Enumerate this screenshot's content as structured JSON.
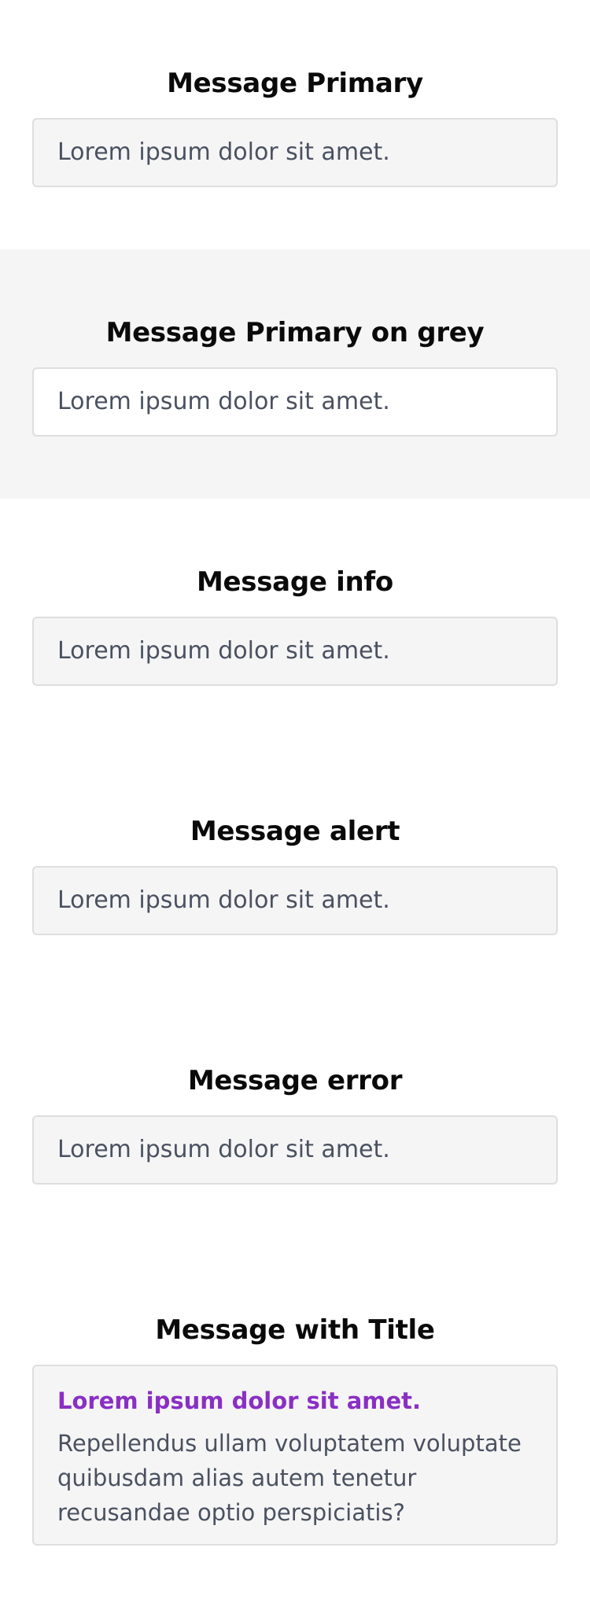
{
  "sections": [
    {
      "title": "Message Primary",
      "text": "Lorem ipsum dolor sit amet."
    },
    {
      "title": "Message Primary on grey",
      "text": "Lorem ipsum dolor sit amet."
    },
    {
      "title": "Message info",
      "text": "Lorem ipsum dolor sit amet."
    },
    {
      "title": "Message alert",
      "text": "Lorem ipsum dolor sit amet."
    },
    {
      "title": "Message error",
      "text": "Lorem ipsum dolor sit amet."
    },
    {
      "title": "Message with Title",
      "heading": "Lorem ipsum dolor sit amet.",
      "body": "Repellendus ullam voluptatem voluptate quibusdam alias autem tenetur recusandae optio perspiciatis?"
    }
  ],
  "colors": {
    "page_background": "#ffffff",
    "grey_section_background": "#f5f5f5",
    "message_background": "#f5f5f5",
    "message_border": "#dedede",
    "message_text": "#4a5160",
    "message_title": "#8a2fc4",
    "heading_text": "#0a0a0a"
  }
}
